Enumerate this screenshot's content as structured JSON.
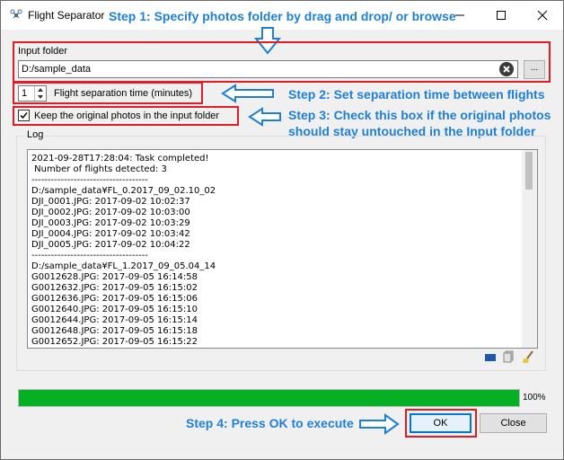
{
  "window": {
    "title": "Flight Separator",
    "app_icon": "drone-icon",
    "controls": [
      "minimize-icon",
      "maximize-icon",
      "close-icon"
    ]
  },
  "annotations": {
    "step1": "Step 1: Specify photos folder by drag and drop/ or browse",
    "step2": "Step 2: Set separation time between flights",
    "step3_line1": "Step 3: Check this box if the original photos",
    "step3_line2": "should stay untouched in the Input folder",
    "step4": "Step 4: Press OK to execute",
    "color": "#1e7fd6",
    "highlight_color": "#e21b25"
  },
  "input_folder": {
    "label": "Input folder",
    "value": "D:/sample_data",
    "browse_label": "..."
  },
  "separation": {
    "value": "1",
    "label": "Flight separation time (minutes)"
  },
  "keep_originals": {
    "checked": true,
    "label": "Keep the original photos in the input folder"
  },
  "log": {
    "label": "Log",
    "lines": [
      "2021-09-28T17:28:04: Task completed!",
      " Number of flights detected: 3",
      "------------------------------------",
      "D:/sample_data¥FL_0.2017_09_02.10_02",
      "DJI_0001.JPG: 2017-09-02 10:02:37",
      "DJI_0002.JPG: 2017-09-02 10:03:00",
      "DJI_0003.JPG: 2017-09-02 10:03:29",
      "DJI_0004.JPG: 2017-09-02 10:03:42",
      "DJI_0005.JPG: 2017-09-02 10:04:22",
      "------------------------------------",
      "D:/sample_data¥FL_1.2017_09_05.04_14",
      "G0012628.JPG: 2017-09-05 16:14:58",
      "G0012632.JPG: 2017-09-05 16:15:02",
      "G0012636.JPG: 2017-09-05 16:15:06",
      "G0012640.JPG: 2017-09-05 16:15:10",
      "G0012644.JPG: 2017-09-05 16:15:14",
      "G0012648.JPG: 2017-09-05 16:15:18",
      "G0012652.JPG: 2017-09-05 16:15:22"
    ],
    "tool_icons": [
      "save-icon",
      "copy-icon",
      "clear-icon"
    ]
  },
  "progress": {
    "percent": 100,
    "text": "100%",
    "color": "#06b025"
  },
  "buttons": {
    "ok": "OK",
    "close": "Close"
  }
}
